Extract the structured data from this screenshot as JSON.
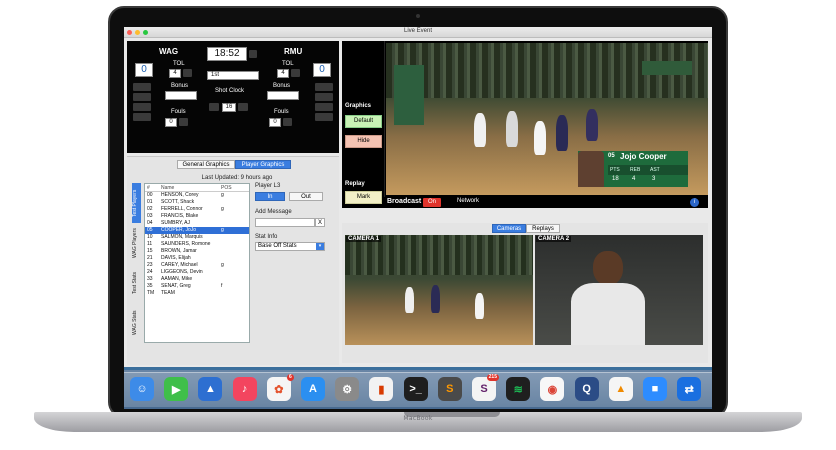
{
  "device": {
    "brand_label": "MacBook"
  },
  "window": {
    "title": "Live Event"
  },
  "scoreboard": {
    "home_team": "WAG",
    "away_team": "RMU",
    "clock": "18:52",
    "home_score": "0",
    "away_score": "0",
    "tol_label": "TOL",
    "home_tol": "4",
    "away_tol": "4",
    "period": "1st",
    "bonus_label": "Bonus",
    "shot_clock_label": "Shot Clock",
    "shot_clock": "16",
    "fouls_label": "Fouls",
    "home_fouls": "0",
    "away_fouls": "0"
  },
  "graphics_controls": {
    "graphics_label": "Graphics",
    "default_button": "Default",
    "hide_button": "Hide",
    "replay_label": "Replay",
    "mark_button": "Mark"
  },
  "broadcast_bar": {
    "broadcast_label": "Broadcast",
    "on_toggle": "On",
    "network_label": "Network",
    "info_icon": "info-icon"
  },
  "lower_third": {
    "number": "05",
    "name": "Jojo Cooper",
    "stat_labels": [
      "PTS",
      "REB",
      "AST"
    ],
    "stat_values": [
      "18",
      "4",
      "3"
    ]
  },
  "graphics_tabs": {
    "general": "General Graphics",
    "player": "Player Graphics"
  },
  "last_updated": "Last Updated: 9 hours ago",
  "side_tabs": [
    "Test Players",
    "WAG Players",
    "Test Stats",
    "WAG Stats"
  ],
  "roster": {
    "columns": [
      "#",
      "Name",
      "POS"
    ],
    "rows": [
      {
        "num": "00",
        "name": "HENSON, Corey",
        "pos": "g"
      },
      {
        "num": "01",
        "name": "SCOTT, Shack",
        "pos": ""
      },
      {
        "num": "02",
        "name": "FERRELL, Connor",
        "pos": "g"
      },
      {
        "num": "03",
        "name": "FRANCIS, Blake",
        "pos": ""
      },
      {
        "num": "04",
        "name": "SUMBRY, AJ",
        "pos": ""
      },
      {
        "num": "05",
        "name": "COOPER, JoJo",
        "pos": "g"
      },
      {
        "num": "10",
        "name": "SALMON, Marquis",
        "pos": ""
      },
      {
        "num": "11",
        "name": "SAUNDERS, Romone",
        "pos": ""
      },
      {
        "num": "15",
        "name": "BROWN, Jamar",
        "pos": ""
      },
      {
        "num": "21",
        "name": "DAVIS, Elijah",
        "pos": ""
      },
      {
        "num": "23",
        "name": "CAREY, Michael",
        "pos": "g"
      },
      {
        "num": "24",
        "name": "LIGGEONS, Devin",
        "pos": ""
      },
      {
        "num": "33",
        "name": "AAMAN, Mike",
        "pos": ""
      },
      {
        "num": "35",
        "name": "SENAT, Greg",
        "pos": "f"
      },
      {
        "num": "TM",
        "name": "TEAM",
        "pos": ""
      }
    ],
    "selected_index": 5
  },
  "player_l3": {
    "label": "Player L3",
    "in_button": "In",
    "out_button": "Out"
  },
  "add_message": {
    "label": "Add Message",
    "value": "",
    "clear_button": "X"
  },
  "stat_info": {
    "label": "Stat Info",
    "selected": "Base Off Stats"
  },
  "camera_tabs": {
    "cameras": "Cameras",
    "replays": "Replays"
  },
  "cameras": [
    {
      "label": "CAMERA 1"
    },
    {
      "label": "CAMERA 2"
    }
  ],
  "dock": {
    "apps": [
      {
        "icon": "finder-icon",
        "color": "#3d8be8"
      },
      {
        "icon": "facetime-icon",
        "color": "#3fbf4a"
      },
      {
        "icon": "keynote-icon",
        "color": "#2d6fd1"
      },
      {
        "icon": "music-icon",
        "color": "#f3455f"
      },
      {
        "icon": "photos-icon",
        "color": "#f5f5f5",
        "badge": "6"
      },
      {
        "icon": "appstore-icon",
        "color": "#2b8ff0"
      },
      {
        "icon": "system-preferences-icon",
        "color": "#8a8a8a"
      },
      {
        "icon": "office-icon",
        "color": "#f2f2f2"
      },
      {
        "icon": "terminal-icon",
        "color": "#1e1e1e"
      },
      {
        "icon": "sublime-icon",
        "color": "#4a4a4a"
      },
      {
        "icon": "slack-icon",
        "color": "#f4f4f4",
        "badge": "215"
      },
      {
        "icon": "spotify-icon",
        "color": "#1f1f1f"
      },
      {
        "icon": "chrome-icon",
        "color": "#f7f7f7"
      },
      {
        "icon": "quicktime-icon",
        "color": "#2b4c86"
      },
      {
        "icon": "vlc-icon",
        "color": "#f5f5f5"
      },
      {
        "icon": "zoom-icon",
        "color": "#2d8cff"
      },
      {
        "icon": "teamviewer-icon",
        "color": "#1a6fe0"
      }
    ]
  }
}
